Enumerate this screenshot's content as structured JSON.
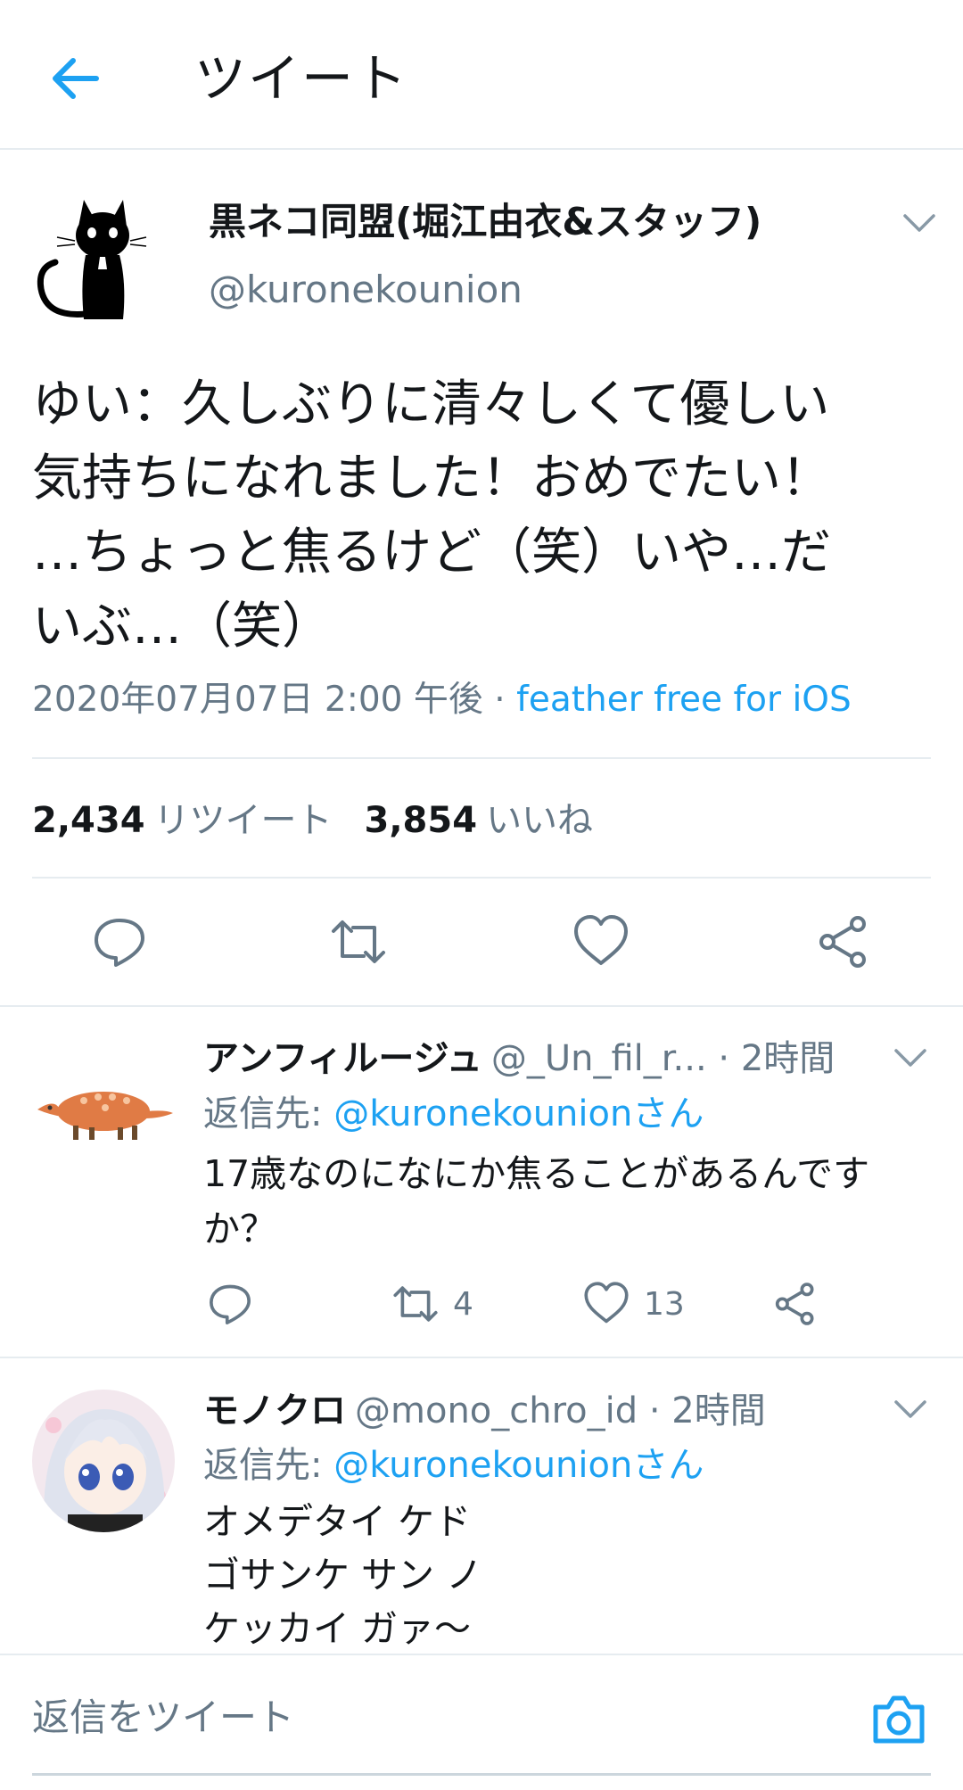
{
  "header": {
    "title": "ツイート"
  },
  "tweet": {
    "author_name": "黒ネコ同盟(堀江由衣&スタッフ)",
    "author_handle": "@kuronekounion",
    "text_lines": [
      "ゆい：久しぶりに清々しくて優しい",
      "気持ちになれました！おめでたい！",
      "…ちょっと焦るけど（笑）いや…だ",
      "いぶ…（笑）"
    ],
    "date": "2020年07月07日 2:00 午後",
    "separator": " · ",
    "source": "feather free for iOS",
    "retweet_count": "2,434",
    "retweet_label": "リツイート",
    "like_count": "3,854",
    "like_label": "いいね"
  },
  "replies": [
    {
      "name": "アンフィルージュ",
      "handle": "@_Un_fil_r...",
      "time": " · 2時間",
      "reply_prefix": "返信先: ",
      "reply_target": "@kuronekounionさん",
      "text_lines": [
        "17歳なのになにか焦ることがあるんです",
        "か？"
      ],
      "retweets": "4",
      "likes": "13"
    },
    {
      "name": "モノクロ",
      "handle": "@mono_chro_id",
      "time": " · 2時間",
      "reply_prefix": "返信先: ",
      "reply_target": "@kuronekounionさん",
      "text_lines": [
        "オメデタイ ケド",
        "ゴサンケ サン ノ",
        "ケッカイ ガァ～"
      ]
    }
  ],
  "compose": {
    "placeholder": "返信をツイート"
  },
  "colors": {
    "accent": "#1da1f2",
    "secondary_text": "#657786",
    "divider": "#e6ecf0"
  }
}
